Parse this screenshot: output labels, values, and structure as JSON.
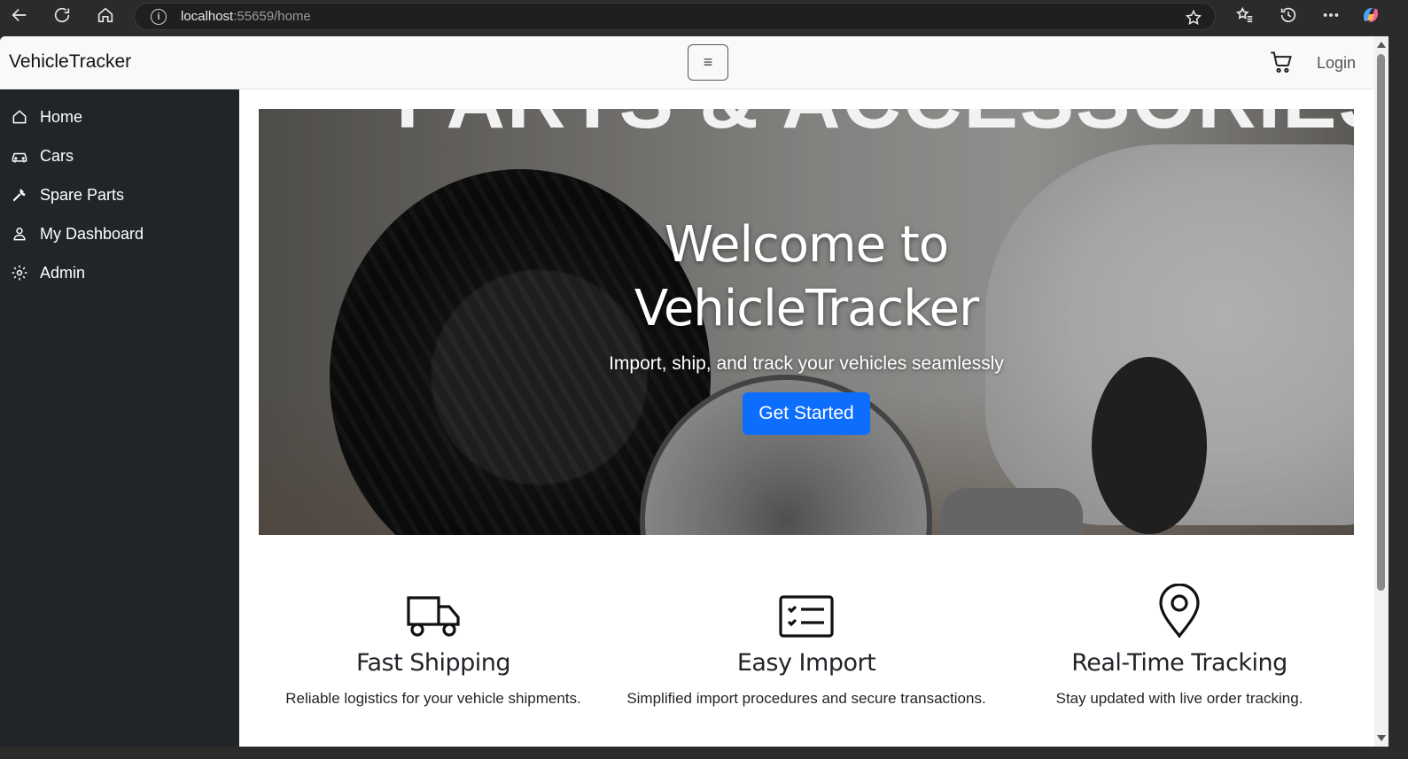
{
  "browser": {
    "url_host": "localhost",
    "url_rest": ":55659/home"
  },
  "topbar": {
    "brand": "VehicleTracker",
    "toggler_glyph": "≡",
    "login_label": "Login"
  },
  "sidebar": {
    "items": [
      {
        "label": "Home",
        "icon": "home-icon"
      },
      {
        "label": "Cars",
        "icon": "car-icon"
      },
      {
        "label": "Spare Parts",
        "icon": "wrench-icon"
      },
      {
        "label": "My Dashboard",
        "icon": "user-icon"
      },
      {
        "label": "Admin",
        "icon": "gear-icon"
      }
    ]
  },
  "hero": {
    "banner_text": "PARTS & ACCESSORIES",
    "title_line1": "Welcome to",
    "title_line2": "VehicleTracker",
    "subtitle": "Import, ship, and track your vehicles seamlessly",
    "cta_label": "Get Started",
    "cta_color": "#0d6efd"
  },
  "features": [
    {
      "icon": "truck-icon",
      "title": "Fast Shipping",
      "text": "Reliable logistics for your vehicle shipments."
    },
    {
      "icon": "checklist-icon",
      "title": "Easy Import",
      "text": "Simplified import procedures and secure transactions."
    },
    {
      "icon": "map-pin-icon",
      "title": "Real-Time Tracking",
      "text": "Stay updated with live order tracking."
    }
  ],
  "colors": {
    "sidebar_bg": "#212529",
    "topbar_bg": "#f8f9fa",
    "accent": "#0d6efd"
  }
}
